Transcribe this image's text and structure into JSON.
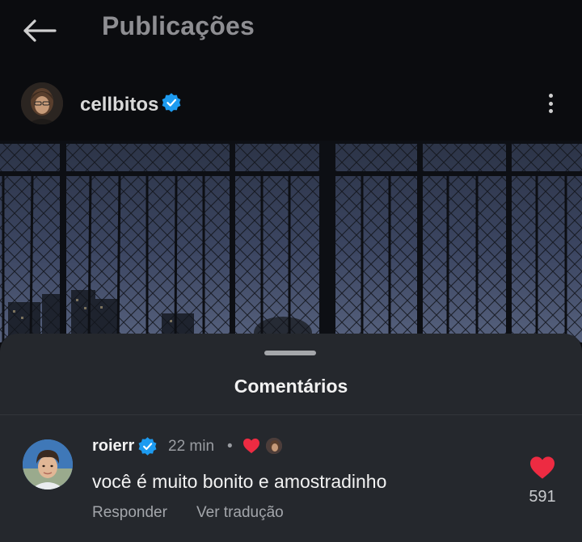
{
  "header": {
    "title": "Publicações",
    "back_icon": "arrow-left-icon"
  },
  "post": {
    "username": "cellbitos",
    "verified": true,
    "more_icon": "more-vertical-icon"
  },
  "comments_sheet": {
    "title": "Comentários",
    "comment": {
      "username": "roierr",
      "verified": true,
      "time": "22 min",
      "separator": "•",
      "liked_by_author": true,
      "text": "você é muito bonito e amostradinho",
      "reply_label": "Responder",
      "translate_label": "Ver tradução",
      "like_count": "591",
      "liked": true
    }
  },
  "colors": {
    "background": "#0b0c0f",
    "sheet": "#25282d",
    "verified": "#1d9bf0",
    "heart": "#ed2b42",
    "muted_text": "#9a9da2"
  }
}
